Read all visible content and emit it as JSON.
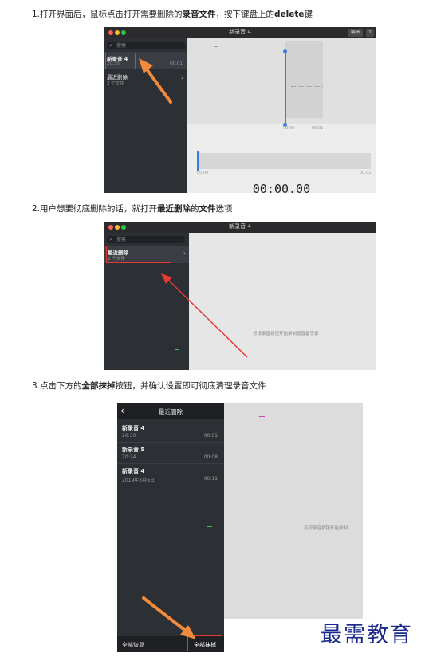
{
  "steps": [
    {
      "parts": [
        {
          "t": "1.打开界面后，鼠标点击打开需要删除的",
          "b": false
        },
        {
          "t": "录音文件",
          "b": true
        },
        {
          "t": "，按下键盘上的",
          "b": false
        },
        {
          "t": "delete",
          "b": true
        },
        {
          "t": "键",
          "b": false
        }
      ]
    },
    {
      "parts": [
        {
          "t": "2.用户想要彻底删除的话，就打开",
          "b": false
        },
        {
          "t": "最近删除",
          "b": true
        },
        {
          "t": "的",
          "b": false
        },
        {
          "t": "文件",
          "b": true
        },
        {
          "t": "选项",
          "b": false
        }
      ]
    },
    {
      "parts": [
        {
          "t": "3.点击下方的",
          "b": false
        },
        {
          "t": "全部抹掉",
          "b": true
        },
        {
          "t": "按钮，并确认设置即可彻底清理录音文件",
          "b": false
        }
      ]
    }
  ],
  "shot1": {
    "window_title": "新录音 4",
    "edit_button": "编辑",
    "search_placeholder": "搜索",
    "recording": {
      "title": "新录音 4",
      "time": "20:30",
      "duration": "00:01"
    },
    "recently_deleted": {
      "title": "最近删除",
      "count": "2 个文件"
    },
    "wave_ticks": [
      "00:00",
      "00:01"
    ],
    "overview_ticks": [
      "00:00",
      "00:01"
    ],
    "timer": "00:00.00"
  },
  "shot2": {
    "window_title": "新录音 4",
    "search_placeholder": "搜索",
    "recently_deleted": {
      "title": "最近删除",
      "count": "2 个文件"
    },
    "hint": "点按录音按钮开始录制语音备忘录"
  },
  "shot3": {
    "header_title": "最近删除",
    "items": [
      {
        "title": "新录音 4",
        "date": "20:30",
        "duration": "00:01"
      },
      {
        "title": "新录音 5",
        "date": "20:24",
        "duration": "00:08"
      },
      {
        "title": "新录音 4",
        "date": "2019年3月6日",
        "duration": "00:11"
      }
    ],
    "recover_all": "全部恢复",
    "erase_all": "全部抹掉",
    "hint": "点按录音按钮开始录制"
  },
  "watermark": "最需教育",
  "colors": {
    "highlight_red": "#e53935",
    "arrow_orange": "#f08a3c",
    "arrow_red": "#e53935",
    "watermark": "#1a2a8c"
  }
}
